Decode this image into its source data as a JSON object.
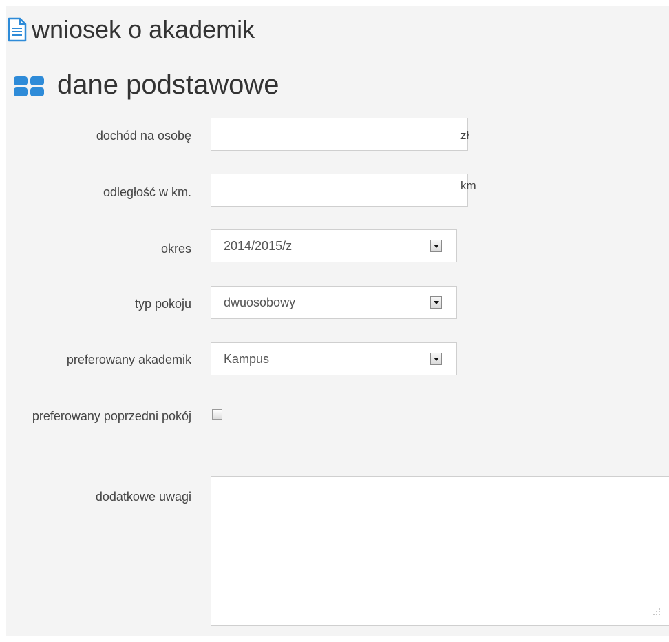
{
  "page": {
    "title": "wniosek o akademik",
    "title_icon": "document-icon",
    "section_title": "dane podstawowe",
    "section_icon": "grid-icon",
    "accent_color": "#2e8bd8"
  },
  "form": {
    "income": {
      "label": "dochód na osobę",
      "value": "",
      "unit": "zł"
    },
    "distance": {
      "label": "odległość w km.",
      "value": "",
      "unit": "km"
    },
    "period": {
      "label": "okres",
      "selected": "2014/2015/z"
    },
    "room_type": {
      "label": "typ pokoju",
      "selected": "dwuosobowy"
    },
    "preferred_dorm": {
      "label": "preferowany akademik",
      "selected": "Kampus"
    },
    "previous_room": {
      "label": "preferowany poprzedni pokój",
      "checked": false
    },
    "notes": {
      "label": "dodatkowe uwagi",
      "value": ""
    }
  }
}
